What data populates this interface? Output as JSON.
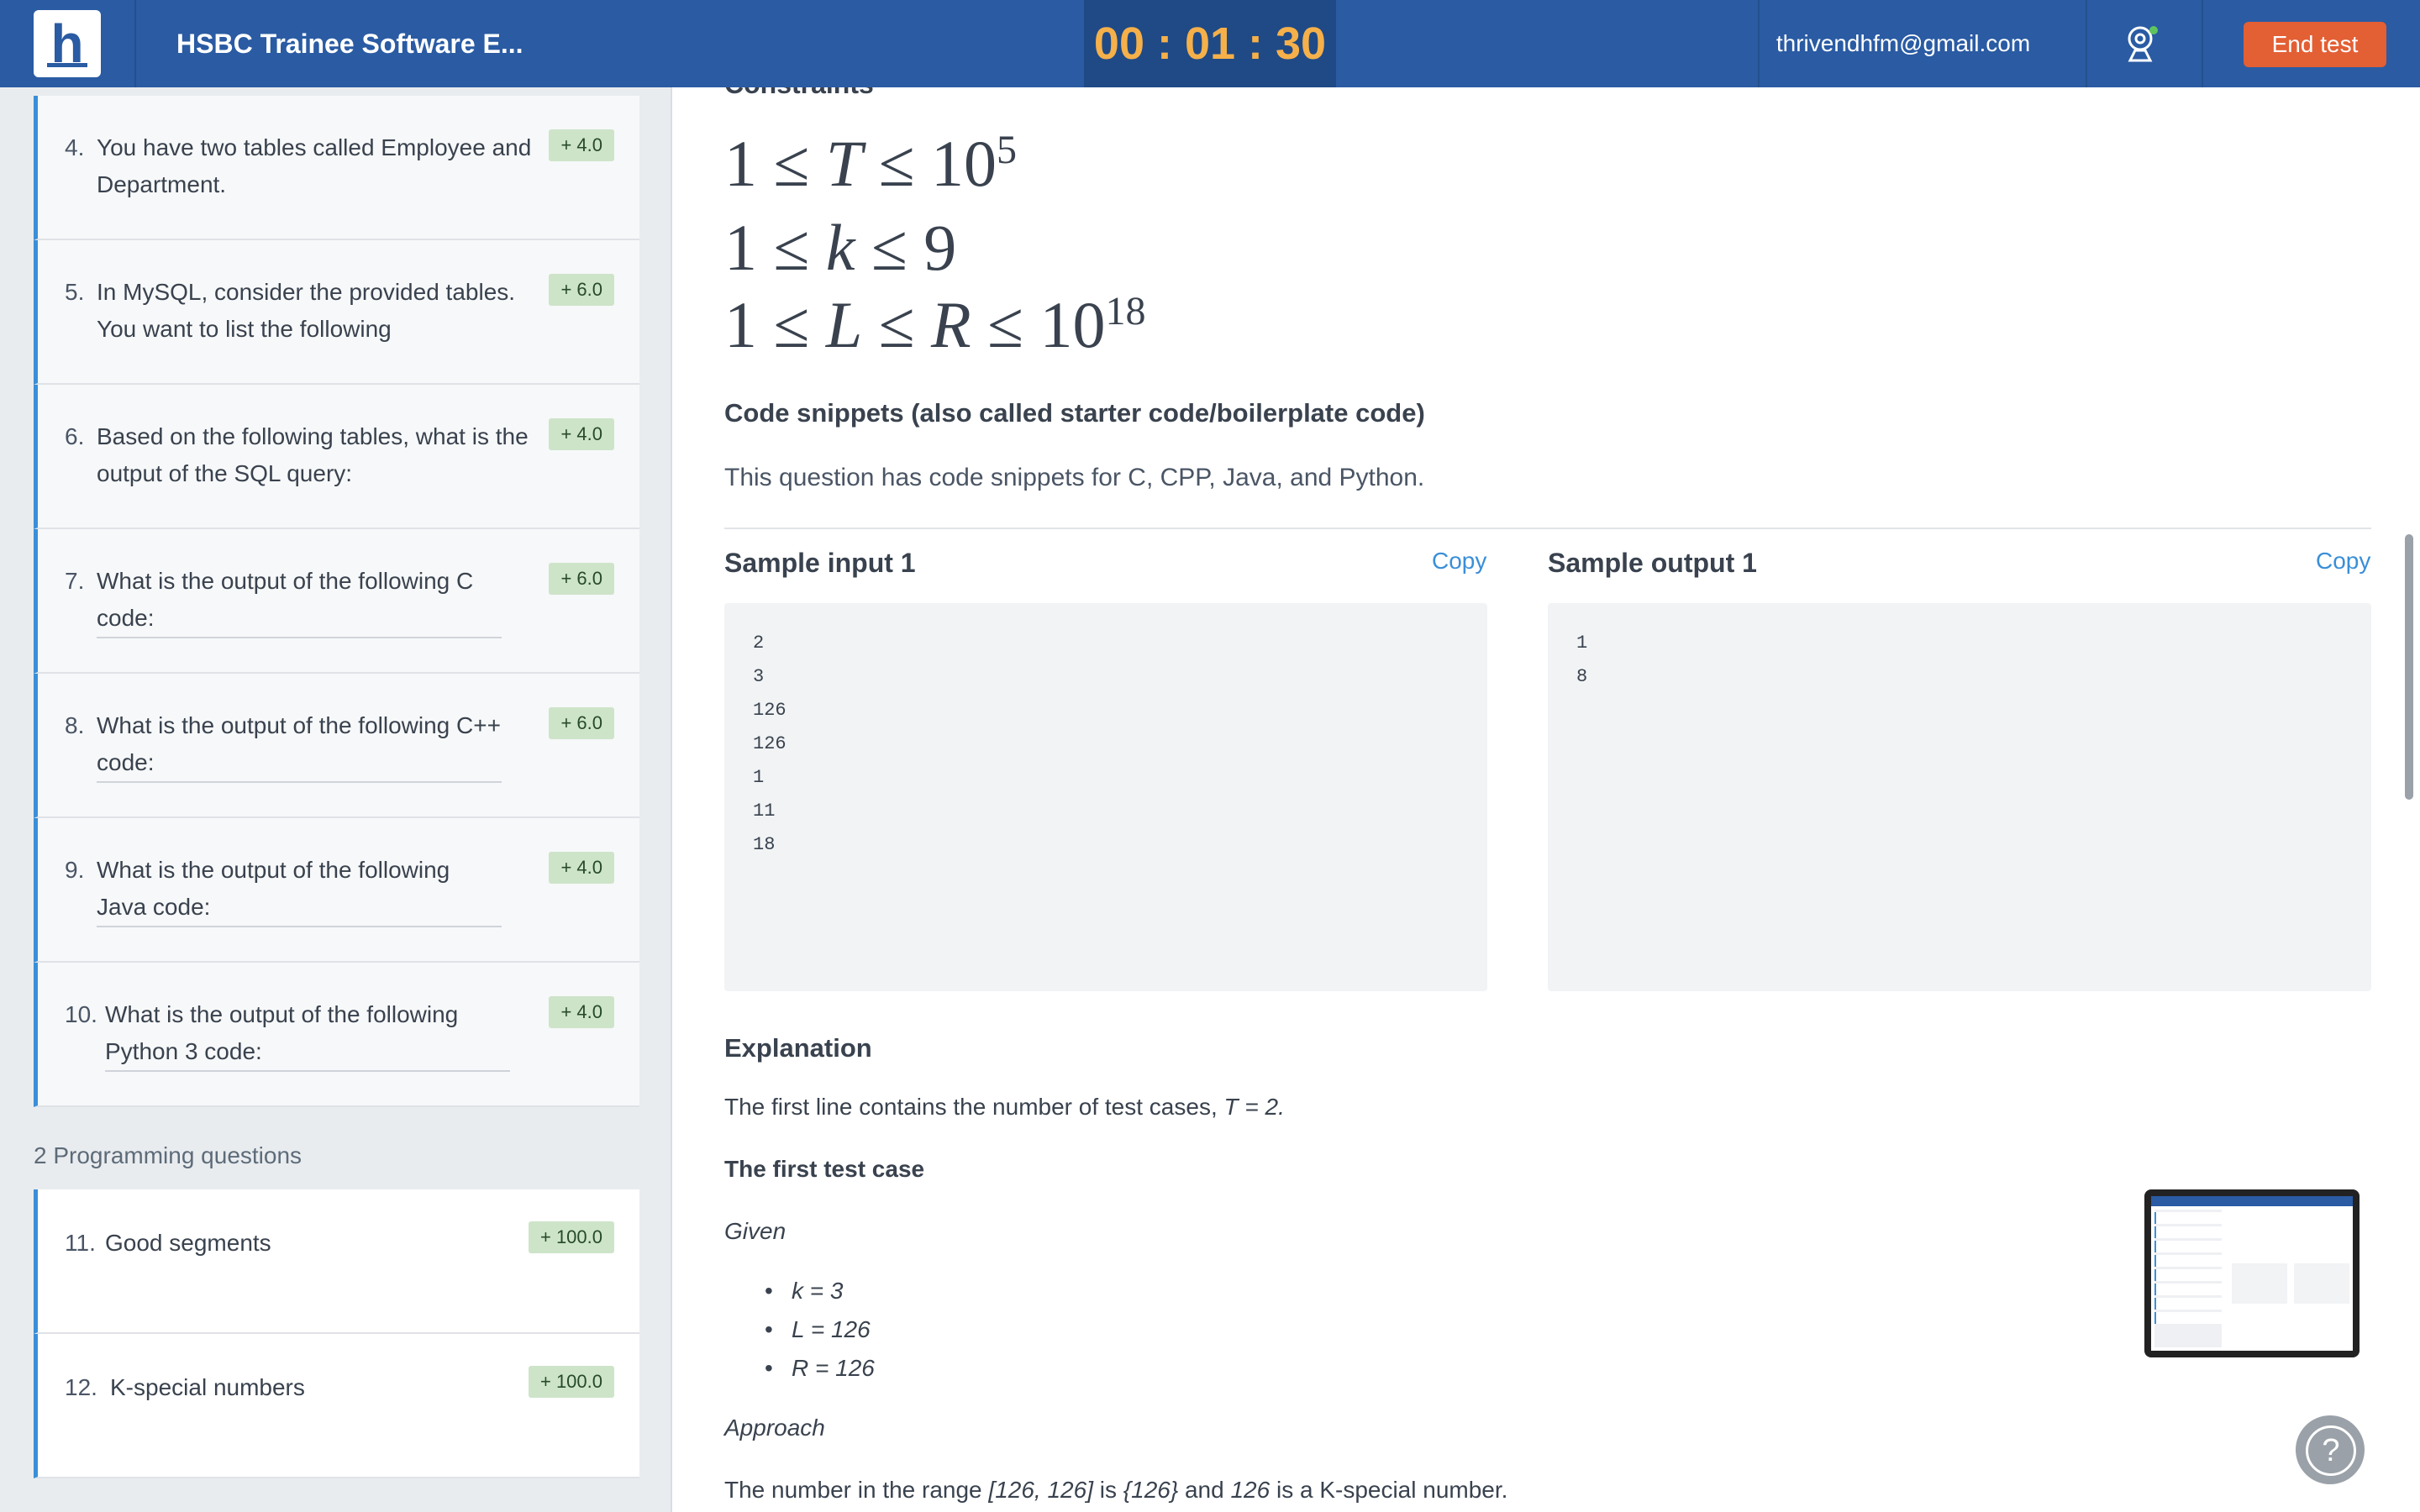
{
  "header": {
    "test_title": "HSBC Trainee Software E...",
    "timer": "00 : 01 : 30",
    "email": "thrivendhfm@gmail.com",
    "end_button": "End test",
    "logo_letter": "h"
  },
  "sidebar": {
    "questions": [
      {
        "num": "4.",
        "text": "You have two tables called Employee and Department.",
        "score": "+ 4.0"
      },
      {
        "num": "5.",
        "text": "In MySQL, consider the provided tables. You want to list the following",
        "score": "+ 6.0"
      },
      {
        "num": "6.",
        "text": "Based on the following tables, what is the output of the SQL query:",
        "score": "+ 4.0"
      },
      {
        "num": "7.",
        "text": "What is the output of the following C code:",
        "score": "+ 6.0"
      },
      {
        "num": "8.",
        "text": "What is the output of the following C++ code:",
        "score": "+ 6.0"
      },
      {
        "num": "9.",
        "text": "What is the output of the following Java code:",
        "score": "+ 4.0"
      },
      {
        "num": "10.",
        "text": "What is the output of the following Python 3 code:",
        "score": "+ 4.0"
      }
    ],
    "programming_label": "2 Programming questions",
    "programming": [
      {
        "num": "11.",
        "text": "Good segments",
        "score": "+ 100.0"
      },
      {
        "num": "12.",
        "text": "K-special numbers",
        "score": "+ 100.0"
      }
    ]
  },
  "main": {
    "constraints_heading": "Constraints",
    "code_snippets_heading": "Code snippets (also called starter code/boilerplate code)",
    "code_snippets_text": "This question has code snippets for C, CPP, Java, and Python.",
    "sample_input_title": "Sample input 1",
    "sample_output_title": "Sample output 1",
    "copy_label": "Copy",
    "sample_input": "2\n3\n126\n126\n1\n11\n18",
    "sample_output": "1\n8",
    "explanation_heading": "Explanation",
    "explanation_line1": "The first line contains the number of test cases, ",
    "explanation_line1_value": "T = 2.",
    "first_case_heading": "The first test case",
    "given_label": "Given",
    "given_items": [
      "k = 3",
      "L = 126",
      "R = 126"
    ],
    "approach_label": "Approach",
    "approach_text_1": "The number in the range ",
    "approach_range": "[126, 126]",
    "approach_text_2": " is ",
    "approach_set": "{126}",
    "approach_text_3": " and ",
    "approach_num": "126",
    "approach_text_4": " is a K-special number."
  }
}
